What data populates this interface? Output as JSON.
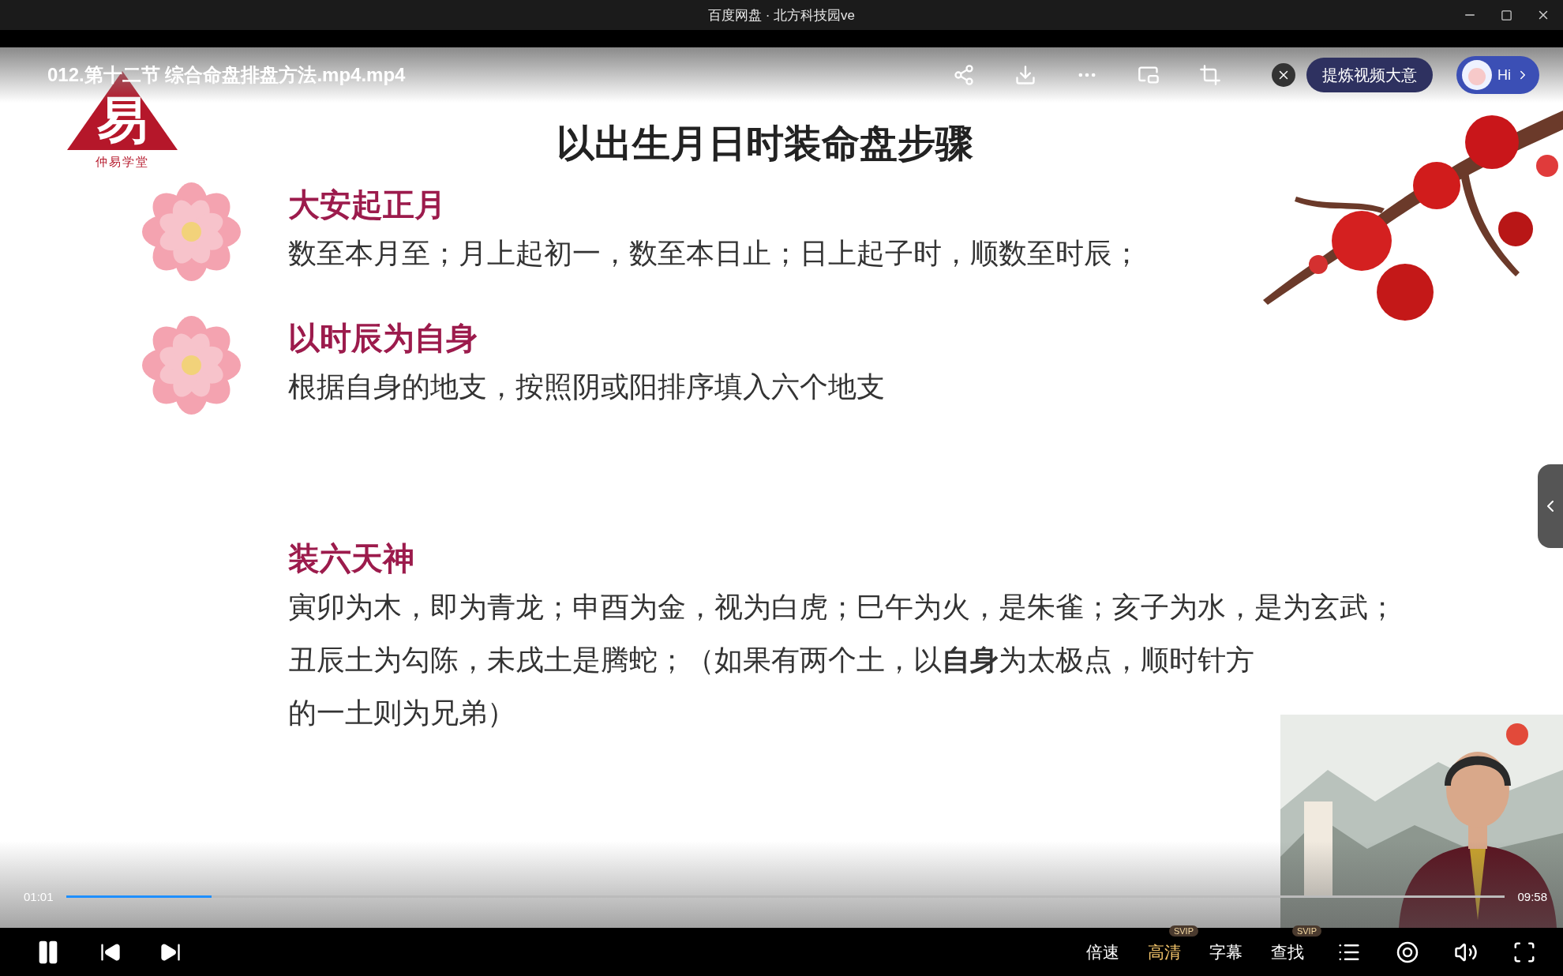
{
  "window": {
    "title": "百度网盘 · 北方科技园ve"
  },
  "player": {
    "file_name": "012.第十二节 综合命盘排盘方法.mp4.mp4",
    "summary_button": "提炼视频大意",
    "assistant_greeting": "Hi"
  },
  "slide": {
    "logo": {
      "mark": "易",
      "caption": "仲易学堂"
    },
    "title": "以出生月日时装命盘步骤",
    "sections": [
      {
        "heading": "大安起正月",
        "flower": true,
        "lines": [
          "数至本月至；月上起初一，数至本日止；日上起子时，顺数至时辰；"
        ]
      },
      {
        "heading": "以时辰为自身",
        "flower": true,
        "lines": [
          "根据自身的地支，按照阴或阳排序填入六个地支"
        ]
      },
      {
        "heading": "装六天神",
        "flower": false,
        "lines": [
          "寅卯为木，即为青龙；申酉为金，视为白虎；巳午为火，是朱雀；亥子为水，是为玄武；",
          "丑辰土为勾陈，未戌土是腾蛇；（如果有两个土，以**自身**为太极点，顺时针方",
          "的一土则为兄弟）"
        ]
      }
    ]
  },
  "progress": {
    "elapsed": "01:01",
    "duration": "09:58",
    "level": 0.101
  },
  "controls": {
    "options": [
      {
        "label": "倍速",
        "selected": false
      },
      {
        "label": "高清",
        "selected": true,
        "badge": "SVIP"
      },
      {
        "label": "字幕",
        "selected": false
      },
      {
        "label": "查找",
        "selected": false,
        "badge": "SVIP"
      }
    ]
  }
}
